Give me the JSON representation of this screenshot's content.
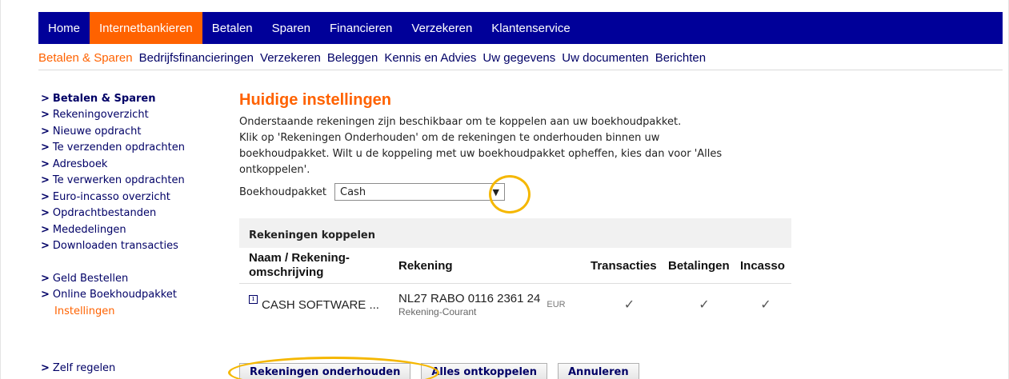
{
  "topnav": {
    "items": [
      {
        "label": "Home",
        "active": false
      },
      {
        "label": "Internetbankieren",
        "active": true
      },
      {
        "label": "Betalen",
        "active": false
      },
      {
        "label": "Sparen",
        "active": false
      },
      {
        "label": "Financieren",
        "active": false
      },
      {
        "label": "Verzekeren",
        "active": false
      },
      {
        "label": "Klantenservice",
        "active": false
      }
    ]
  },
  "subnav": {
    "items": [
      {
        "label": "Betalen & Sparen",
        "active": true
      },
      {
        "label": "Bedrijfsfinancieringen",
        "active": false
      },
      {
        "label": "Verzekeren",
        "active": false
      },
      {
        "label": "Beleggen",
        "active": false
      },
      {
        "label": "Kennis en Advies",
        "active": false
      },
      {
        "label": "Uw gegevens",
        "active": false
      },
      {
        "label": "Uw documenten",
        "active": false
      },
      {
        "label": "Berichten",
        "active": false
      }
    ]
  },
  "sidebar": {
    "heading": "Betalen & Sparen",
    "links": [
      "Rekeningoverzicht",
      "Nieuwe opdracht",
      "Te verzenden opdrachten",
      "Adresboek",
      "Te verwerken opdrachten",
      "Euro-incasso overzicht",
      "Opdrachtbestanden",
      "Mededelingen",
      "Downloaden transacties"
    ],
    "links2": [
      "Geld Bestellen",
      "Online Boekhoudpakket"
    ],
    "sub_active": "Instellingen",
    "bottom_link": "Zelf regelen",
    "chevron": ">"
  },
  "main": {
    "title": "Huidige instellingen",
    "intro_lines": [
      "Onderstaande rekeningen zijn beschikbaar om te koppelen aan uw boekhoudpakket.",
      "Klik op 'Rekeningen Onderhouden' om de rekeningen te onderhouden binnen uw",
      "boekhoudpakket. Wilt u de koppeling met uw boekhoudpakket opheffen, kies dan voor 'Alles",
      "ontkoppelen'."
    ],
    "package_label": "Boekhoudpakket",
    "package_value": "Cash",
    "package_arrow": "▼"
  },
  "accounts": {
    "header": "Rekeningen koppelen",
    "columns": {
      "naam_1": "Naam / Rekening-",
      "naam_2": "omschrijving",
      "rekening": "Rekening",
      "transacties": "Transacties",
      "betalingen": "Betalingen",
      "incasso": "Incasso"
    },
    "row": {
      "info_icon": "i",
      "name": "CASH SOFTWARE ...",
      "iban": "NL27 RABO 0116 2361 24",
      "type": "Rekening-Courant",
      "currency": "EUR",
      "check": "✓"
    }
  },
  "buttons": {
    "maintain": "Rekeningen onderhouden",
    "unlink_all": "Alles ontkoppelen",
    "cancel": "Annuleren"
  },
  "colors": {
    "nav_bg": "#000099",
    "accent": "#ff6200",
    "highlight": "#f5b700"
  }
}
